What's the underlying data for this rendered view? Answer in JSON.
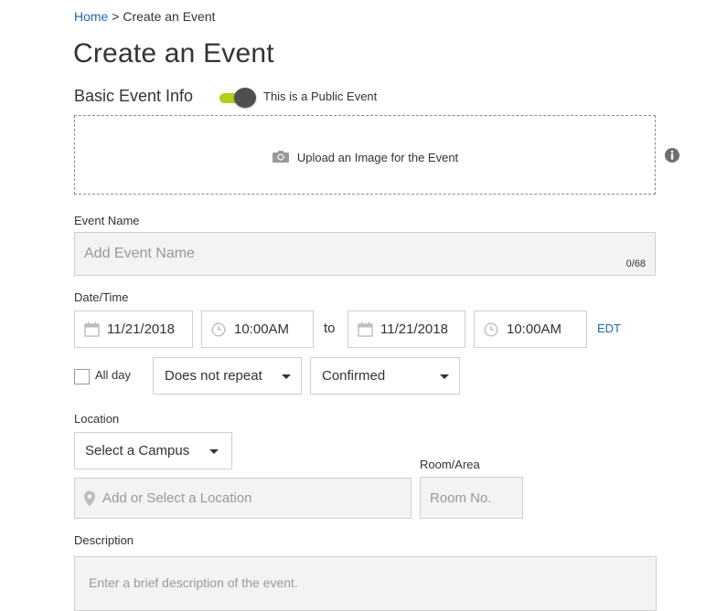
{
  "breadcrumb": {
    "home": "Home",
    "separator": " > ",
    "current": "Create an Event"
  },
  "page_title": "Create an Event",
  "basic_info": {
    "title": "Basic Event Info",
    "public_toggle": {
      "label": "This is a Public Event",
      "on": true,
      "color": "#b8cc1c"
    }
  },
  "upload": {
    "label": "Upload an Image for the Event",
    "icon": "camera-icon",
    "info_icon": "info-icon"
  },
  "event_name": {
    "label": "Event Name",
    "placeholder": "Add Event Name",
    "counter": "0/68"
  },
  "datetime": {
    "label": "Date/Time",
    "start_date": "11/21/2018",
    "start_time": "10:00AM",
    "to_label": "to",
    "end_date": "11/21/2018",
    "end_time": "10:00AM",
    "timezone": "EDT"
  },
  "options": {
    "all_day_label": "All day",
    "all_day_checked": false,
    "repeat": "Does not repeat",
    "status": "Confirmed"
  },
  "location": {
    "label": "Location",
    "campus": "Select a Campus",
    "location_placeholder": "Add or Select a Location",
    "room_label": "Room/Area",
    "room_placeholder": "Room No."
  },
  "description": {
    "label": "Description",
    "placeholder": "Enter a brief description of the event."
  },
  "colors": {
    "link": "#1f6aa8",
    "toggle_track": "#b8cc1c",
    "input_bg": "#f3f3f3",
    "border": "#cfcfcf"
  }
}
